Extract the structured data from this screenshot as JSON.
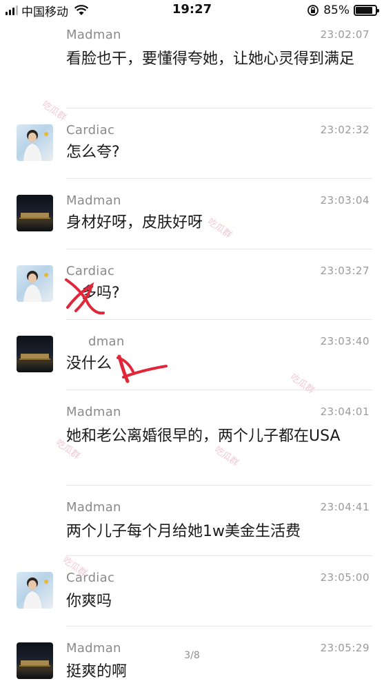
{
  "status_bar": {
    "carrier": "中国移动",
    "time": "19:27",
    "battery_percent": "85%",
    "battery_level": 0.85
  },
  "messages": [
    {
      "sender": "Madman",
      "time": "23:02:07",
      "text": "看脸也干，要懂得夸她，让她心灵得到满足",
      "avatar": "none"
    },
    {
      "sender": "Cardiac",
      "time": "23:02:32",
      "text": "怎么夸?",
      "avatar": "user-a"
    },
    {
      "sender": "Madman",
      "time": "23:03:04",
      "text": "身材好呀，皮肤好呀",
      "avatar": "user-b"
    },
    {
      "sender": "Cardiac",
      "time": "23:03:27",
      "text": "多吗?",
      "avatar": "user-a"
    },
    {
      "sender": "dman",
      "time": "23:03:40",
      "text": "没什么",
      "avatar": "user-b"
    },
    {
      "sender": "Madman",
      "time": "23:04:01",
      "text": "她和老公离婚很早的，两个儿子都在USA",
      "avatar": "none"
    },
    {
      "sender": "Madman",
      "time": "23:04:41",
      "text": "两个儿子每个月给她1w美金生活费",
      "avatar": "none"
    },
    {
      "sender": "Cardiac",
      "time": "23:05:00",
      "text": "你爽吗",
      "avatar": "user-a"
    },
    {
      "sender": "Madman",
      "time": "23:05:29",
      "text": "挺爽的啊",
      "avatar": "user-b"
    }
  ],
  "page_indicator": "3/8",
  "watermark": "吃瓜群",
  "colors": {
    "sender": "#8a8a8a",
    "timestamp": "#9a9a9a",
    "annotation": "#e0273a"
  }
}
